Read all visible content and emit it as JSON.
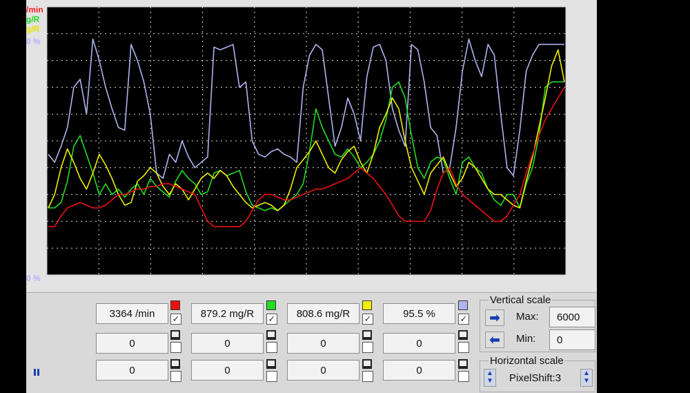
{
  "yaxis": {
    "labels": [
      {
        "text": "/min",
        "color": "#ff2020"
      },
      {
        "text": "g/R",
        "color": "#22dd22"
      },
      {
        "text": "g/R",
        "color": "#e6e600"
      },
      {
        "text": "0 %",
        "color": "#b0b0ff"
      }
    ],
    "bottom_label": "0 %"
  },
  "channels": [
    {
      "value": "3364 /min",
      "color": "#ee1111",
      "checked": true
    },
    {
      "value": "879.2 mg/R",
      "color": "#22dd22",
      "checked": true
    },
    {
      "value": "808.6 mg/R",
      "color": "#f0f000",
      "checked": true
    },
    {
      "value": "95.5 %",
      "color": "#b0b4ee",
      "checked": true
    }
  ],
  "row2_values": [
    "0",
    "0",
    "0",
    "0"
  ],
  "row3_values": [
    "0",
    "0",
    "0",
    "0"
  ],
  "vertical_scale": {
    "title": "Vertical scale",
    "max_label": "Max:",
    "max_value": "6000",
    "min_label": "Min:",
    "min_value": "0"
  },
  "horizontal_scale": {
    "title": "Horizontal scale",
    "pixelshift": "PixelShift:3"
  },
  "pause_icon": "pause-icon",
  "chart_data": {
    "type": "line",
    "series": [
      {
        "color": "#b0b4ee",
        "values": [
          0.45,
          0.42,
          0.48,
          0.55,
          0.7,
          0.73,
          0.6,
          0.88,
          0.8,
          0.7,
          0.62,
          0.55,
          0.54,
          0.86,
          0.8,
          0.72,
          0.6,
          0.38,
          0.36,
          0.45,
          0.42,
          0.5,
          0.44,
          0.4,
          0.42,
          0.44,
          0.85,
          0.84,
          0.85,
          0.86,
          0.7,
          0.72,
          0.5,
          0.45,
          0.44,
          0.46,
          0.47,
          0.45,
          0.44,
          0.42,
          0.7,
          0.82,
          0.86,
          0.84,
          0.66,
          0.48,
          0.55,
          0.66,
          0.6,
          0.5,
          0.74,
          0.85,
          0.86,
          0.8,
          0.62,
          0.54,
          0.48,
          0.86,
          0.84,
          0.72,
          0.55,
          0.52,
          0.38,
          0.4,
          0.55,
          0.76,
          0.88,
          0.8,
          0.74,
          0.86,
          0.82,
          0.6,
          0.4,
          0.37,
          0.54,
          0.76,
          0.82,
          0.86,
          0.86,
          0.86,
          0.86,
          0.86
        ]
      },
      {
        "color": "#22dd22",
        "values": [
          0.25,
          0.25,
          0.27,
          0.35,
          0.48,
          0.52,
          0.45,
          0.38,
          0.3,
          0.34,
          0.3,
          0.32,
          0.29,
          0.32,
          0.34,
          0.3,
          0.36,
          0.33,
          0.31,
          0.29,
          0.35,
          0.39,
          0.36,
          0.34,
          0.3,
          0.31,
          0.38,
          0.39,
          0.37,
          0.38,
          0.39,
          0.31,
          0.26,
          0.25,
          0.24,
          0.25,
          0.24,
          0.26,
          0.28,
          0.3,
          0.34,
          0.46,
          0.62,
          0.55,
          0.5,
          0.45,
          0.44,
          0.47,
          0.44,
          0.4,
          0.42,
          0.45,
          0.5,
          0.58,
          0.7,
          0.72,
          0.66,
          0.52,
          0.4,
          0.36,
          0.42,
          0.44,
          0.43,
          0.36,
          0.3,
          0.42,
          0.44,
          0.4,
          0.38,
          0.32,
          0.28,
          0.26,
          0.3,
          0.3,
          0.25,
          0.34,
          0.4,
          0.52,
          0.7,
          0.72,
          0.72,
          0.72
        ]
      },
      {
        "color": "#f0f000",
        "values": [
          0.25,
          0.3,
          0.4,
          0.47,
          0.42,
          0.36,
          0.32,
          0.38,
          0.45,
          0.41,
          0.36,
          0.3,
          0.26,
          0.27,
          0.35,
          0.37,
          0.4,
          0.38,
          0.33,
          0.3,
          0.34,
          0.32,
          0.28,
          0.32,
          0.36,
          0.38,
          0.36,
          0.39,
          0.37,
          0.33,
          0.3,
          0.27,
          0.25,
          0.26,
          0.27,
          0.26,
          0.24,
          0.26,
          0.32,
          0.4,
          0.43,
          0.46,
          0.5,
          0.45,
          0.4,
          0.38,
          0.43,
          0.46,
          0.48,
          0.42,
          0.38,
          0.45,
          0.55,
          0.6,
          0.66,
          0.62,
          0.5,
          0.4,
          0.35,
          0.3,
          0.38,
          0.41,
          0.44,
          0.38,
          0.33,
          0.36,
          0.42,
          0.4,
          0.36,
          0.32,
          0.3,
          0.3,
          0.28,
          0.26,
          0.25,
          0.35,
          0.44,
          0.55,
          0.66,
          0.78,
          0.84,
          0.72
        ]
      },
      {
        "color": "#ee1111",
        "values": [
          0.18,
          0.18,
          0.22,
          0.25,
          0.26,
          0.27,
          0.26,
          0.25,
          0.25,
          0.26,
          0.28,
          0.3,
          0.3,
          0.31,
          0.32,
          0.32,
          0.33,
          0.33,
          0.34,
          0.34,
          0.33,
          0.32,
          0.31,
          0.3,
          0.25,
          0.2,
          0.18,
          0.18,
          0.18,
          0.18,
          0.18,
          0.2,
          0.24,
          0.28,
          0.3,
          0.3,
          0.29,
          0.28,
          0.28,
          0.29,
          0.3,
          0.31,
          0.32,
          0.32,
          0.33,
          0.34,
          0.35,
          0.36,
          0.38,
          0.4,
          0.38,
          0.36,
          0.33,
          0.3,
          0.26,
          0.22,
          0.2,
          0.2,
          0.2,
          0.2,
          0.24,
          0.32,
          0.38,
          0.4,
          0.34,
          0.3,
          0.28,
          0.26,
          0.24,
          0.22,
          0.2,
          0.2,
          0.22,
          0.26,
          0.3,
          0.38,
          0.45,
          0.52,
          0.58,
          0.62,
          0.66,
          0.7
        ]
      }
    ],
    "ylim": [
      0,
      1
    ]
  }
}
